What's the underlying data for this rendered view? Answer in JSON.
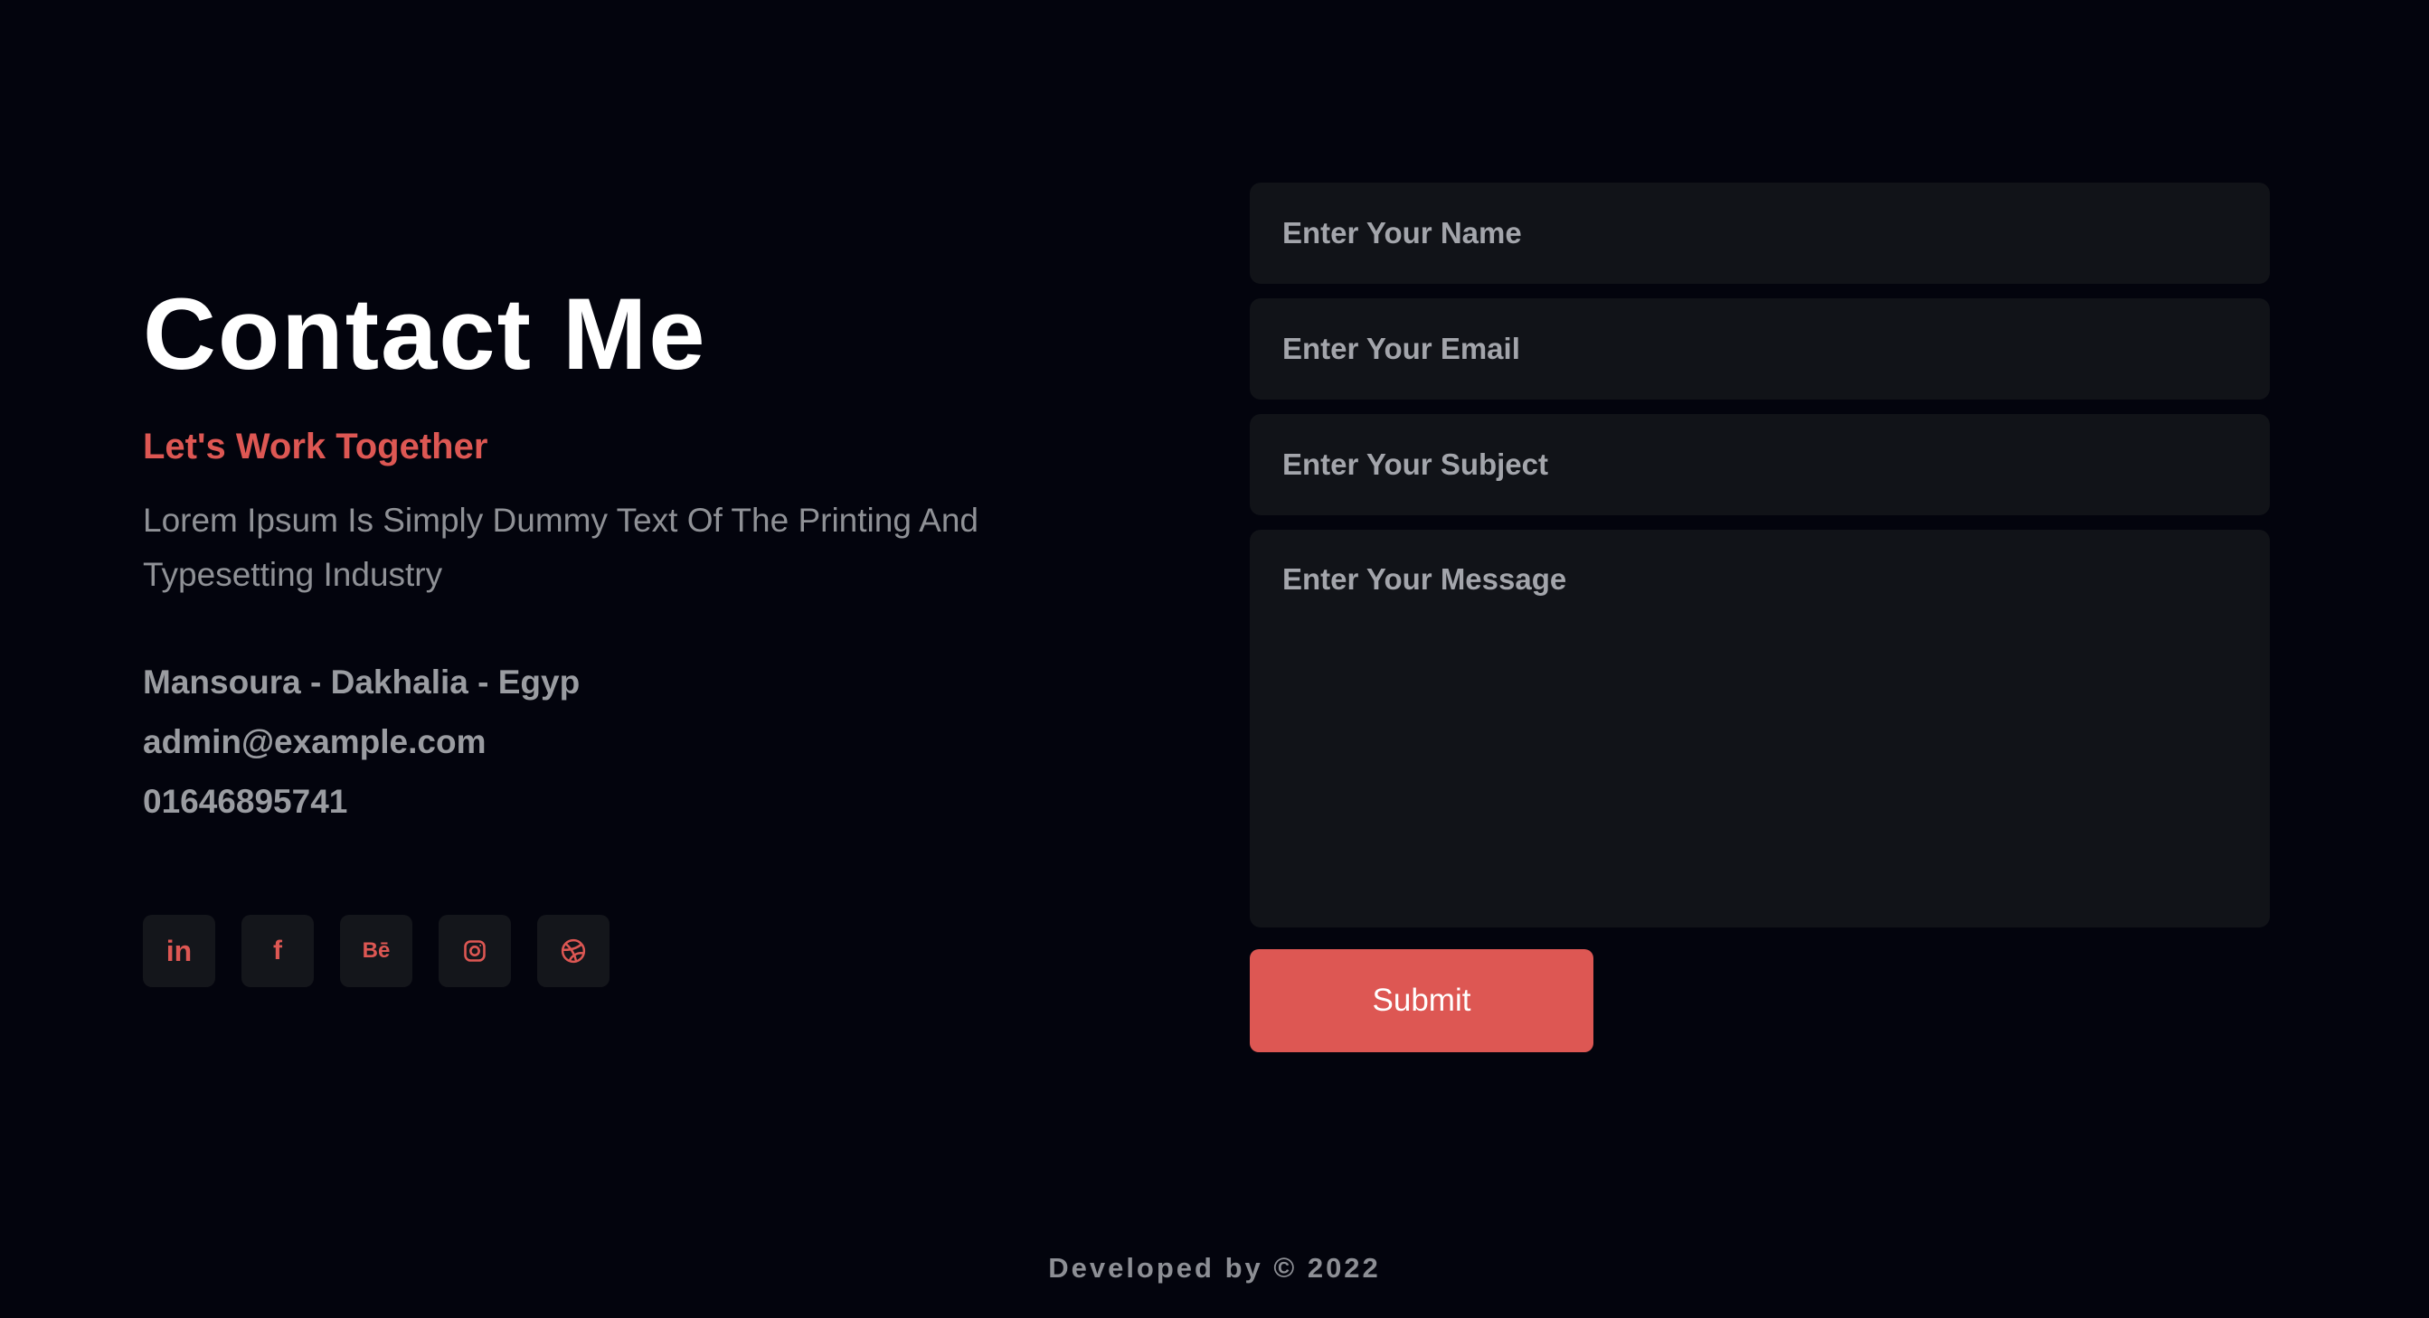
{
  "contact": {
    "title": "Contact Me",
    "subtitle": "Let's Work Together",
    "description": "Lorem Ipsum Is Simply Dummy Text Of The Printing And Typesetting Industry",
    "address": "Mansoura - Dakhalia - Egyp",
    "email": "admin@example.com",
    "phone": "01646895741"
  },
  "socials": [
    {
      "name": "linkedin-icon",
      "label": "in"
    },
    {
      "name": "facebook-icon",
      "label": "f"
    },
    {
      "name": "behance-icon",
      "label": "Bē"
    },
    {
      "name": "instagram-icon",
      "label": ""
    },
    {
      "name": "dribbble-icon",
      "label": ""
    }
  ],
  "form": {
    "name_placeholder": "Enter Your Name",
    "email_placeholder": "Enter Your Email",
    "subject_placeholder": "Enter Your Subject",
    "message_placeholder": "Enter Your Message",
    "submit_label": "Submit"
  },
  "footer": {
    "text": "Developed by © 2022"
  },
  "colors": {
    "background": "#03040d",
    "accent": "#dd5753",
    "field_background": "#111318"
  }
}
